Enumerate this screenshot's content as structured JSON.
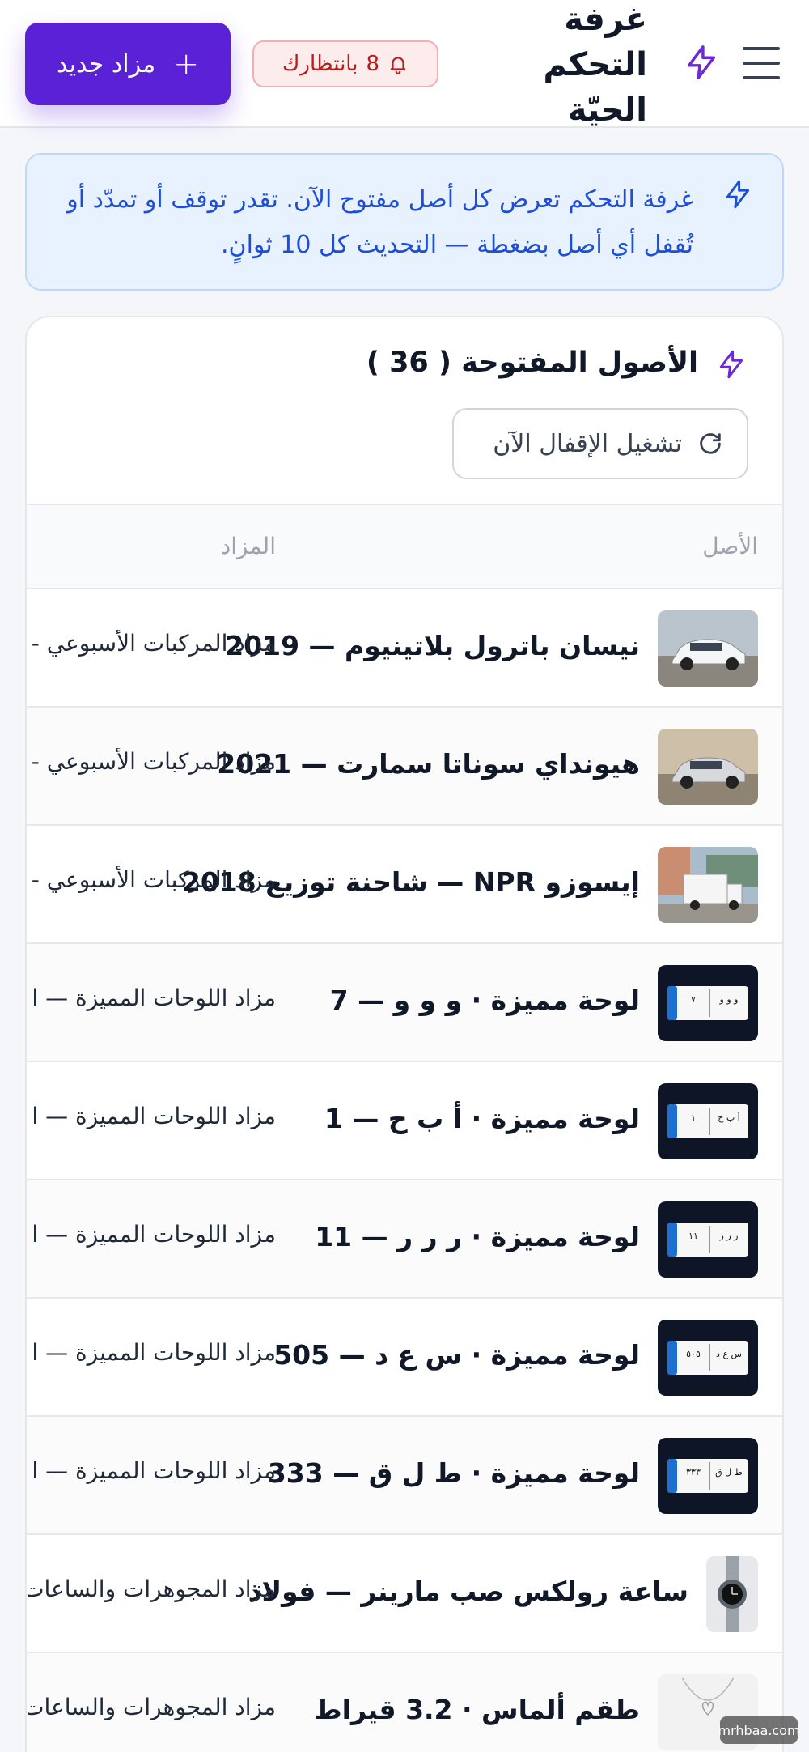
{
  "header": {
    "title": "غرفة التحكم الحيّة",
    "pending_count": "8",
    "pending_label": "بانتظارك",
    "new_auction_label": "مزاد جديد"
  },
  "banner": {
    "text": "غرفة التحكم تعرض كل أصل مفتوح الآن. تقدر توقف أو تمدّد أو تُقفل أي أصل بضغطة — التحديث كل 10 ثوانٍ."
  },
  "card": {
    "title": "الأصول المفتوحة ( 36 )",
    "refresh_label": "تشغيل الإقفال الآن"
  },
  "table": {
    "columns": {
      "asset": "الأصل",
      "auction": "المزاد"
    },
    "rows": [
      {
        "asset": "نيسان باترول بلاتينيوم — 2019",
        "auction": "مزاد المركبات الأسبوعي -",
        "thumb": "car-icon"
      },
      {
        "asset": "هيونداي سوناتا سمارت — 2021",
        "auction": "مزاد المركبات الأسبوعي -",
        "thumb": "car-icon"
      },
      {
        "asset": "إيسوزو NPR — شاحنة توزيع 2018",
        "auction": "مزاد المركبات الأسبوعي -",
        "thumb": "truck-icon"
      },
      {
        "asset": "لوحة مميزة · و و و — 7",
        "auction": "مزاد اللوحات المميزة — ا",
        "thumb": "plate-icon",
        "plate_ar": "و و و",
        "plate_num": "٧"
      },
      {
        "asset": "لوحة مميزة · أ ب ح — 1",
        "auction": "مزاد اللوحات المميزة — ا",
        "thumb": "plate-icon",
        "plate_ar": "أ ب ح",
        "plate_num": "١"
      },
      {
        "asset": "لوحة مميزة · ر ر ر — 11",
        "auction": "مزاد اللوحات المميزة — ا",
        "thumb": "plate-icon",
        "plate_ar": "ر ر ر",
        "plate_num": "١١"
      },
      {
        "asset": "لوحة مميزة · س ع د — 505",
        "auction": "مزاد اللوحات المميزة — ا",
        "thumb": "plate-icon",
        "plate_ar": "س ع د",
        "plate_num": "٥٠٥"
      },
      {
        "asset": "لوحة مميزة · ط ل ق — 333",
        "auction": "مزاد اللوحات المميزة — ا",
        "thumb": "plate-icon",
        "plate_ar": "ط ل ق",
        "plate_num": "٣٣٣"
      },
      {
        "asset": "ساعة رولكس صب مارينر — فولاذ",
        "auction": "مزاد المجوهرات والساعات",
        "thumb": "watch-icon"
      },
      {
        "asset": "طقم ألماس · 3.2 قيراط",
        "auction": "مزاد المجوهرات والساعات",
        "thumb": "necklace-icon"
      }
    ]
  },
  "watermark": "mrhbaa.com",
  "colors": {
    "accent": "#5b21d6",
    "info_bg": "#e8f2fe",
    "info_text": "#1d4ed8",
    "badge_bg": "#fdecec",
    "badge_text": "#b91c1c"
  }
}
